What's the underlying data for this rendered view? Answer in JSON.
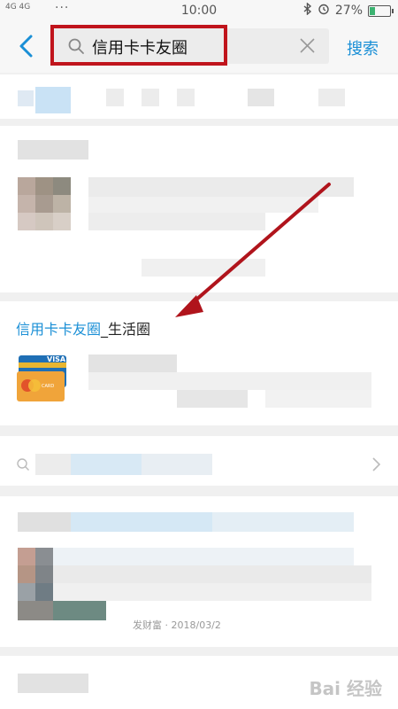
{
  "status_bar": {
    "network": "4G 4G",
    "dots": "···",
    "time": "10:00",
    "battery_percent": "27%",
    "battery_level": 0.27
  },
  "search": {
    "query": "信用卡卡友圈",
    "button_label": "搜索"
  },
  "circle_result": {
    "title_highlight": "信用卡卡友圈",
    "title_suffix": "_生活圈"
  },
  "result_meta": {
    "date_fragment": "发财富 · 2018/03/2"
  },
  "watermark": "Bai 经验"
}
